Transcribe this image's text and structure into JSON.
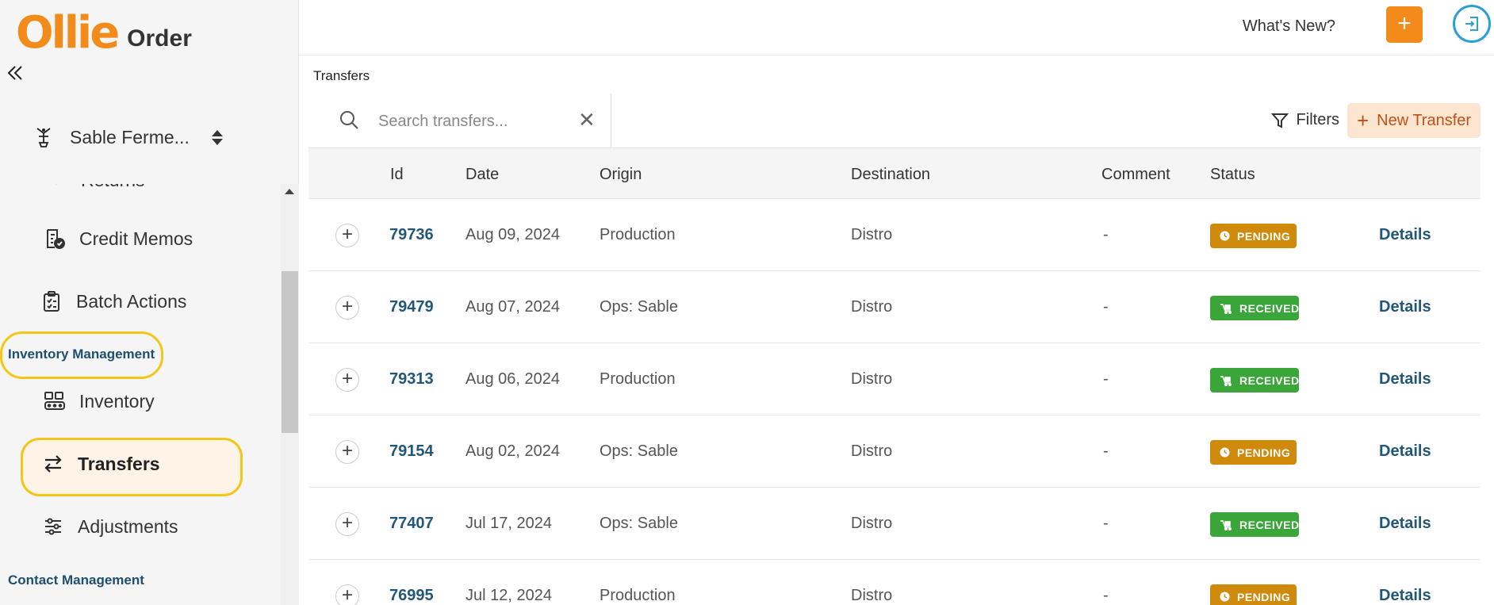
{
  "app": {
    "logo_main": "Ollie",
    "logo_sub": "Order",
    "collapse_icon": "double-chevron-left-icon"
  },
  "account": {
    "name": "Sable Ferme..."
  },
  "sidebar": {
    "items": [
      {
        "label": "Returns",
        "icon": "returns-icon"
      },
      {
        "label": "Credit Memos",
        "icon": "credit-memo-icon"
      },
      {
        "label": "Batch Actions",
        "icon": "clipboard-icon"
      },
      {
        "label": "Inventory",
        "icon": "inventory-icon"
      },
      {
        "label": "Transfers",
        "icon": "transfer-arrows-icon"
      },
      {
        "label": "Adjustments",
        "icon": "sliders-icon"
      }
    ],
    "sections": {
      "inventory": "Inventory Management",
      "contacts": "Contact Management"
    }
  },
  "topbar": {
    "whats_new": "What's New?",
    "plus_label": "+"
  },
  "breadcrumb": "Transfers",
  "search": {
    "placeholder": "Search transfers...",
    "value": ""
  },
  "toolbar": {
    "filters_label": "Filters",
    "new_transfer_label": "New Transfer"
  },
  "table": {
    "headers": [
      "Id",
      "Date",
      "Origin",
      "Destination",
      "Comment",
      "Status"
    ],
    "rows": [
      {
        "id": "79736",
        "date": "Aug 09, 2024",
        "origin": "Production",
        "destination": "Distro",
        "comment": "-",
        "status": "PENDING",
        "action": "Details"
      },
      {
        "id": "79479",
        "date": "Aug 07, 2024",
        "origin": "Ops: Sable",
        "destination": "Distro",
        "comment": "-",
        "status": "RECEIVED",
        "action": "Details"
      },
      {
        "id": "79313",
        "date": "Aug 06, 2024",
        "origin": "Production",
        "destination": "Distro",
        "comment": "-",
        "status": "RECEIVED",
        "action": "Details"
      },
      {
        "id": "79154",
        "date": "Aug 02, 2024",
        "origin": "Ops: Sable",
        "destination": "Distro",
        "comment": "-",
        "status": "PENDING",
        "action": "Details"
      },
      {
        "id": "77407",
        "date": "Jul 17, 2024",
        "origin": "Ops: Sable",
        "destination": "Distro",
        "comment": "-",
        "status": "RECEIVED",
        "action": "Details"
      },
      {
        "id": "76995",
        "date": "Jul 12, 2024",
        "origin": "Production",
        "destination": "Distro",
        "comment": "-",
        "status": "PENDING",
        "action": "Details"
      }
    ]
  },
  "colors": {
    "brand_orange": "#f28b1a",
    "pending": "#cf8a0c",
    "received": "#3aa63a",
    "link": "#23577a",
    "highlight": "#f5c518"
  }
}
